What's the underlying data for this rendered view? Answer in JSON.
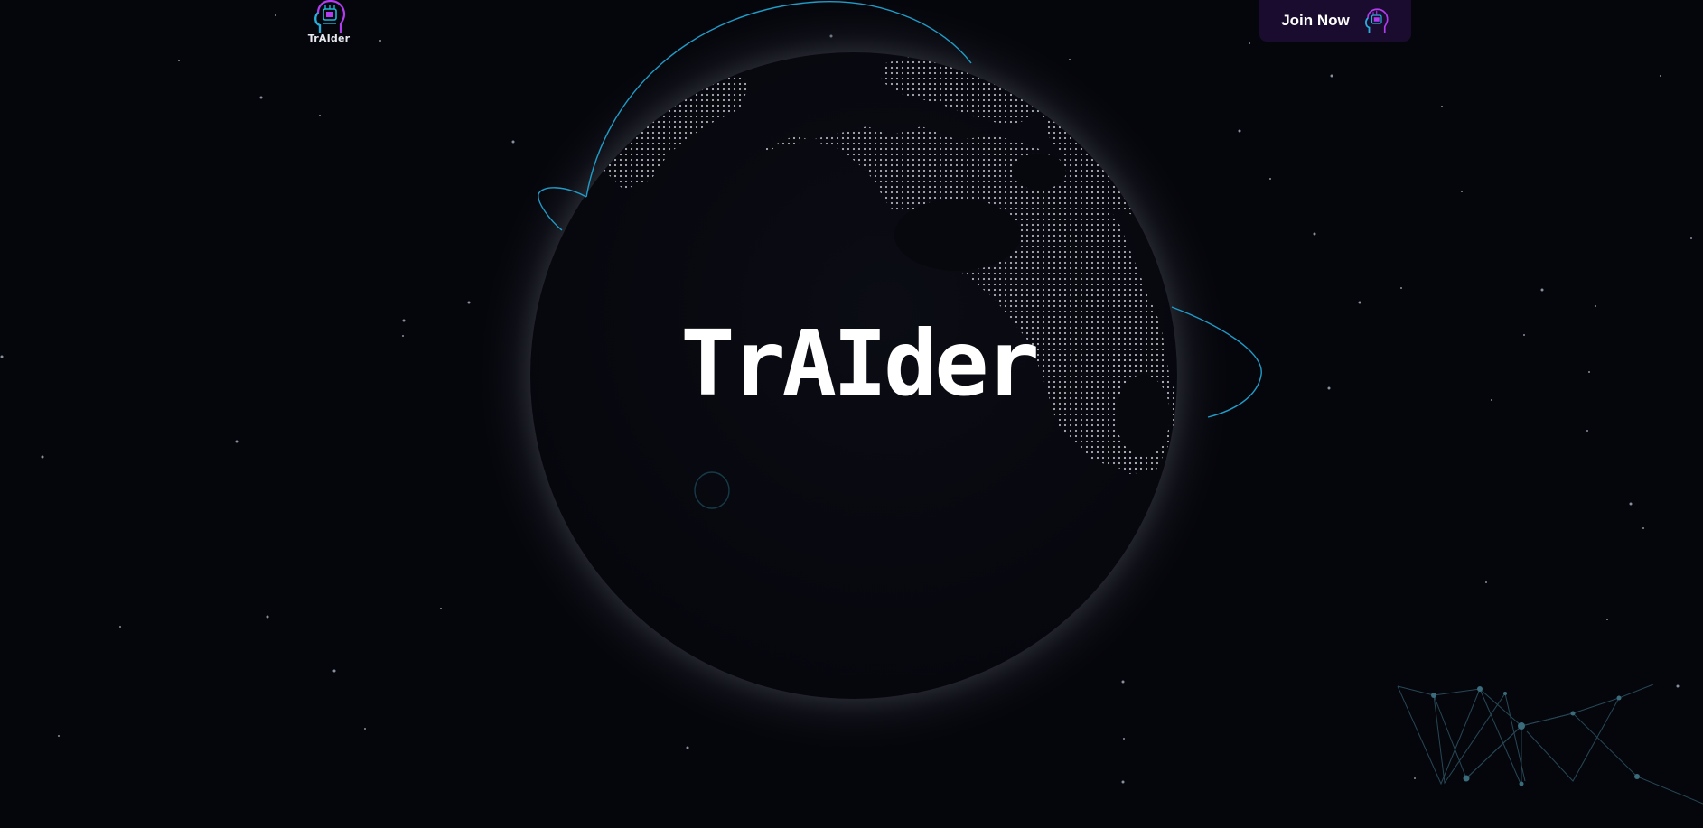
{
  "brand": {
    "logo_icon": "robot-head-brain-icon",
    "logo_text": "TrAIder"
  },
  "nav": {
    "join_label": "Join Now",
    "join_icon": "robot-head-brain-icon"
  },
  "hero": {
    "title": "TrAIder"
  },
  "colors": {
    "background": "#05060c",
    "accent_cyan": "#1fb3d6",
    "accent_purple": "#b13cf0",
    "button_bg": "#1a0c2e"
  }
}
